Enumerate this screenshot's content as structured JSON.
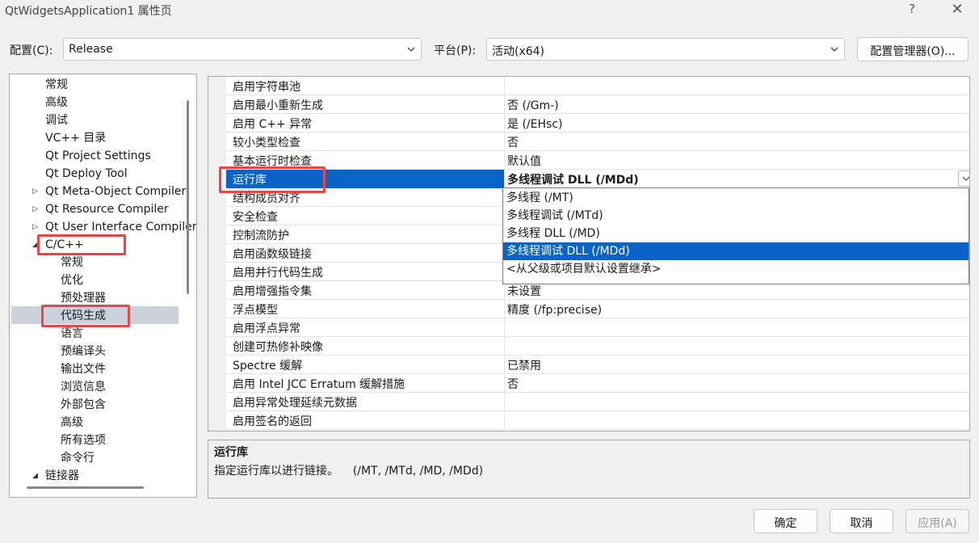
{
  "window": {
    "title": "QtWidgetsApplication1 属性页",
    "help": "?",
    "close": "✕"
  },
  "config": {
    "label": "配置(C):",
    "value": "Release"
  },
  "platform": {
    "label": "平台(P):",
    "value": "活动(x64)"
  },
  "config_manager": {
    "label": "配置管理器(O)..."
  },
  "tree": {
    "items": [
      {
        "label": "常规"
      },
      {
        "label": "高级"
      },
      {
        "label": "调试"
      },
      {
        "label": "VC++ 目录"
      },
      {
        "label": "Qt Project Settings"
      },
      {
        "label": "Qt Deploy Tool"
      },
      {
        "label": "Qt Meta-Object Compiler"
      },
      {
        "label": "Qt Resource Compiler"
      },
      {
        "label": "Qt User Interface Compiler"
      },
      {
        "label": "C/C++"
      },
      {
        "label": "常规"
      },
      {
        "label": "优化"
      },
      {
        "label": "预处理器"
      },
      {
        "label": "代码生成"
      },
      {
        "label": "语言"
      },
      {
        "label": "预编译头"
      },
      {
        "label": "输出文件"
      },
      {
        "label": "浏览信息"
      },
      {
        "label": "外部包含"
      },
      {
        "label": "高级"
      },
      {
        "label": "所有选项"
      },
      {
        "label": "命令行"
      },
      {
        "label": "链接器"
      }
    ]
  },
  "properties": [
    {
      "name": "启用字符串池",
      "value": ""
    },
    {
      "name": "启用最小重新生成",
      "value": "否 (/Gm-)"
    },
    {
      "name": "启用 C++ 异常",
      "value": "是 (/EHsc)"
    },
    {
      "name": "较小类型检查",
      "value": "否"
    },
    {
      "name": "基本运行时检查",
      "value": "默认值"
    },
    {
      "name": "运行库",
      "value": "多线程调试 DLL (/MDd)"
    },
    {
      "name": "结构成员对齐",
      "value": ""
    },
    {
      "name": "安全检查",
      "value": ""
    },
    {
      "name": "控制流防护",
      "value": ""
    },
    {
      "name": "启用函数级链接",
      "value": ""
    },
    {
      "name": "启用并行代码生成",
      "value": ""
    },
    {
      "name": "启用增强指令集",
      "value": "未设置"
    },
    {
      "name": "浮点模型",
      "value": "精度 (/fp:precise)"
    },
    {
      "name": "启用浮点异常",
      "value": ""
    },
    {
      "name": "创建可热修补映像",
      "value": ""
    },
    {
      "name": "Spectre 缓解",
      "value": "已禁用"
    },
    {
      "name": "启用 Intel JCC Erratum 缓解措施",
      "value": "否"
    },
    {
      "name": "启用异常处理延续元数据",
      "value": ""
    },
    {
      "name": "启用签名的返回",
      "value": ""
    }
  ],
  "dropdown": {
    "options": [
      {
        "label": "多线程 (/MT)"
      },
      {
        "label": "多线程调试 (/MTd)"
      },
      {
        "label": "多线程 DLL (/MD)"
      },
      {
        "label": "多线程调试 DLL (/MDd)"
      },
      {
        "label": "<从父级或项目默认设置继承>"
      }
    ],
    "selected": "多线程调试 DLL (/MDd)"
  },
  "description": {
    "title": "运行库",
    "text": "指定运行库以进行链接。    (/MT, /MTd, /MD, /MDd)"
  },
  "buttons": {
    "ok": "确定",
    "cancel": "取消",
    "apply": "应用(A)"
  },
  "colors": {
    "selection": "#0a64c8",
    "highlight_box": "#e64848",
    "tree_selection": "#ccd2dc"
  }
}
